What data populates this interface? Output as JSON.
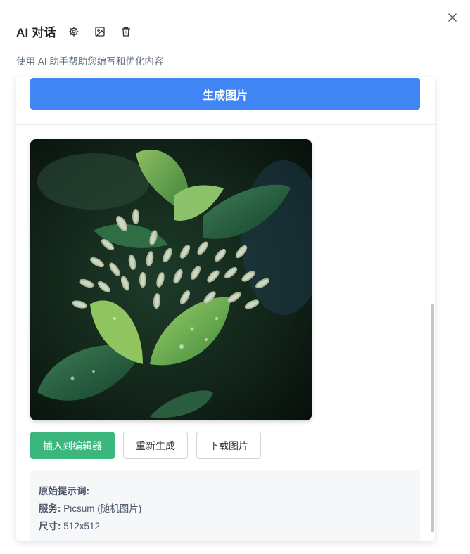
{
  "dialog": {
    "title": "AI 对话",
    "subtitle": "使用 AI 助手帮助您编写和优化内容",
    "header_icons": [
      "gear-icon",
      "image-icon",
      "trash-icon"
    ],
    "close_icon": "close-icon"
  },
  "panel": {
    "generate_button": "生成图片",
    "actions": {
      "insert": "插入到编辑器",
      "regenerate": "重新生成",
      "download": "下载图片"
    },
    "info": {
      "prompt_label": "原始提示词:",
      "service_label": "服务:",
      "service_value": "Picsum (随机图片)",
      "size_label": "尺寸:",
      "size_value": "512x512"
    }
  },
  "colors": {
    "primary_blue": "#4285f4",
    "insert_green": "#3bb77e"
  }
}
